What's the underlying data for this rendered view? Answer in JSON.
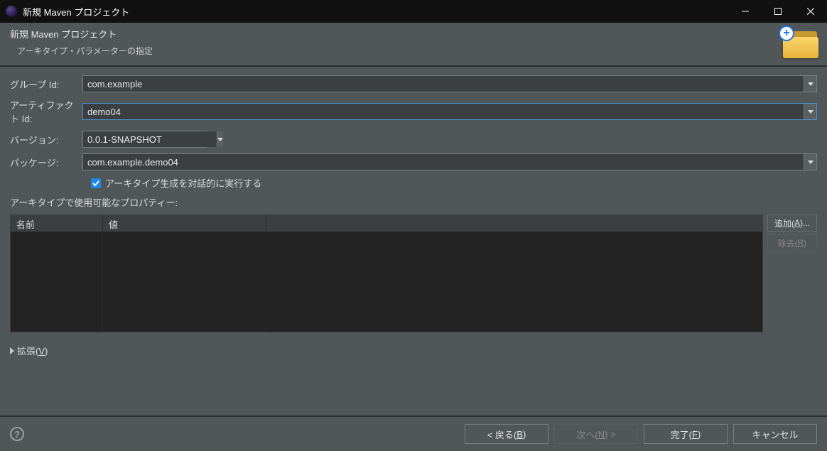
{
  "title": "新規 Maven プロジェクト",
  "header": {
    "h1": "新規 Maven プロジェクト",
    "h2": "アーキタイプ・パラメーターの指定"
  },
  "labels": {
    "group_id": "グループ Id:",
    "artifact_id": "アーティファクト Id:",
    "version": "バージョン:",
    "package": "パッケージ:",
    "interactive_checkbox": "アーキタイプ生成を対話的に実行する",
    "properties_section": "アーキタイプで使用可能なプロパティー:",
    "col_name": "名前",
    "col_value": "値",
    "add_btn_pre": "追加(",
    "add_btn_mn": "A",
    "add_btn_post": ")...",
    "remove_btn_pre": "除去(",
    "remove_btn_mn": "R",
    "remove_btn_post": ")",
    "expand_pre": "拡張(",
    "expand_mn": "V",
    "expand_post": ")"
  },
  "values": {
    "group_id": "com.example",
    "artifact_id": "demo04",
    "version": "0.0.1-SNAPSHOT",
    "package": "com.example.demo04"
  },
  "buttons": {
    "back_pre": "< 戻る(",
    "back_mn": "B",
    "back_post": ")",
    "next_pre": "次へ(",
    "next_mn": "N",
    "next_post": ") >",
    "finish_pre": "完了(",
    "finish_mn": "F",
    "finish_post": ")",
    "cancel": "キャンセル"
  }
}
